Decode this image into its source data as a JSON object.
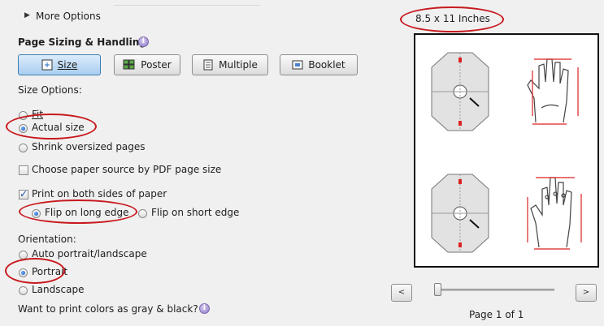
{
  "more_options": {
    "label": "More Options"
  },
  "page_sizing": {
    "heading": "Page Sizing & Handling",
    "buttons": [
      {
        "label": "Size",
        "active": true
      },
      {
        "label": "Poster",
        "active": false
      },
      {
        "label": "Multiple",
        "active": false
      },
      {
        "label": "Booklet",
        "active": false
      }
    ],
    "size_options_label": "Size Options:",
    "size_options": [
      {
        "label": "Fit",
        "selected": false
      },
      {
        "label": "Actual size",
        "selected": true
      },
      {
        "label": "Shrink oversized pages",
        "selected": false
      }
    ],
    "choose_paper_source": {
      "label": "Choose paper source by PDF page size",
      "checked": false
    },
    "print_both_sides": {
      "label": "Print on both sides of paper",
      "checked": true
    },
    "flip_options": [
      {
        "label": "Flip on long edge",
        "selected": true
      },
      {
        "label": "Flip on short edge",
        "selected": false
      }
    ]
  },
  "orientation": {
    "label": "Orientation:",
    "options": [
      {
        "label": "Auto portrait/landscape",
        "selected": false
      },
      {
        "label": "Portrait",
        "selected": true
      },
      {
        "label": "Landscape",
        "selected": false
      }
    ]
  },
  "gray_question": "Want to print colors as gray & black?",
  "preview": {
    "paper_size": "8.5 x 11 Inches",
    "page_indicator": "Page 1 of 1",
    "prev_icon": "<",
    "next_icon": ">"
  },
  "colors": {
    "accent": "#3c7fb1",
    "annotation": "#c8191e"
  }
}
